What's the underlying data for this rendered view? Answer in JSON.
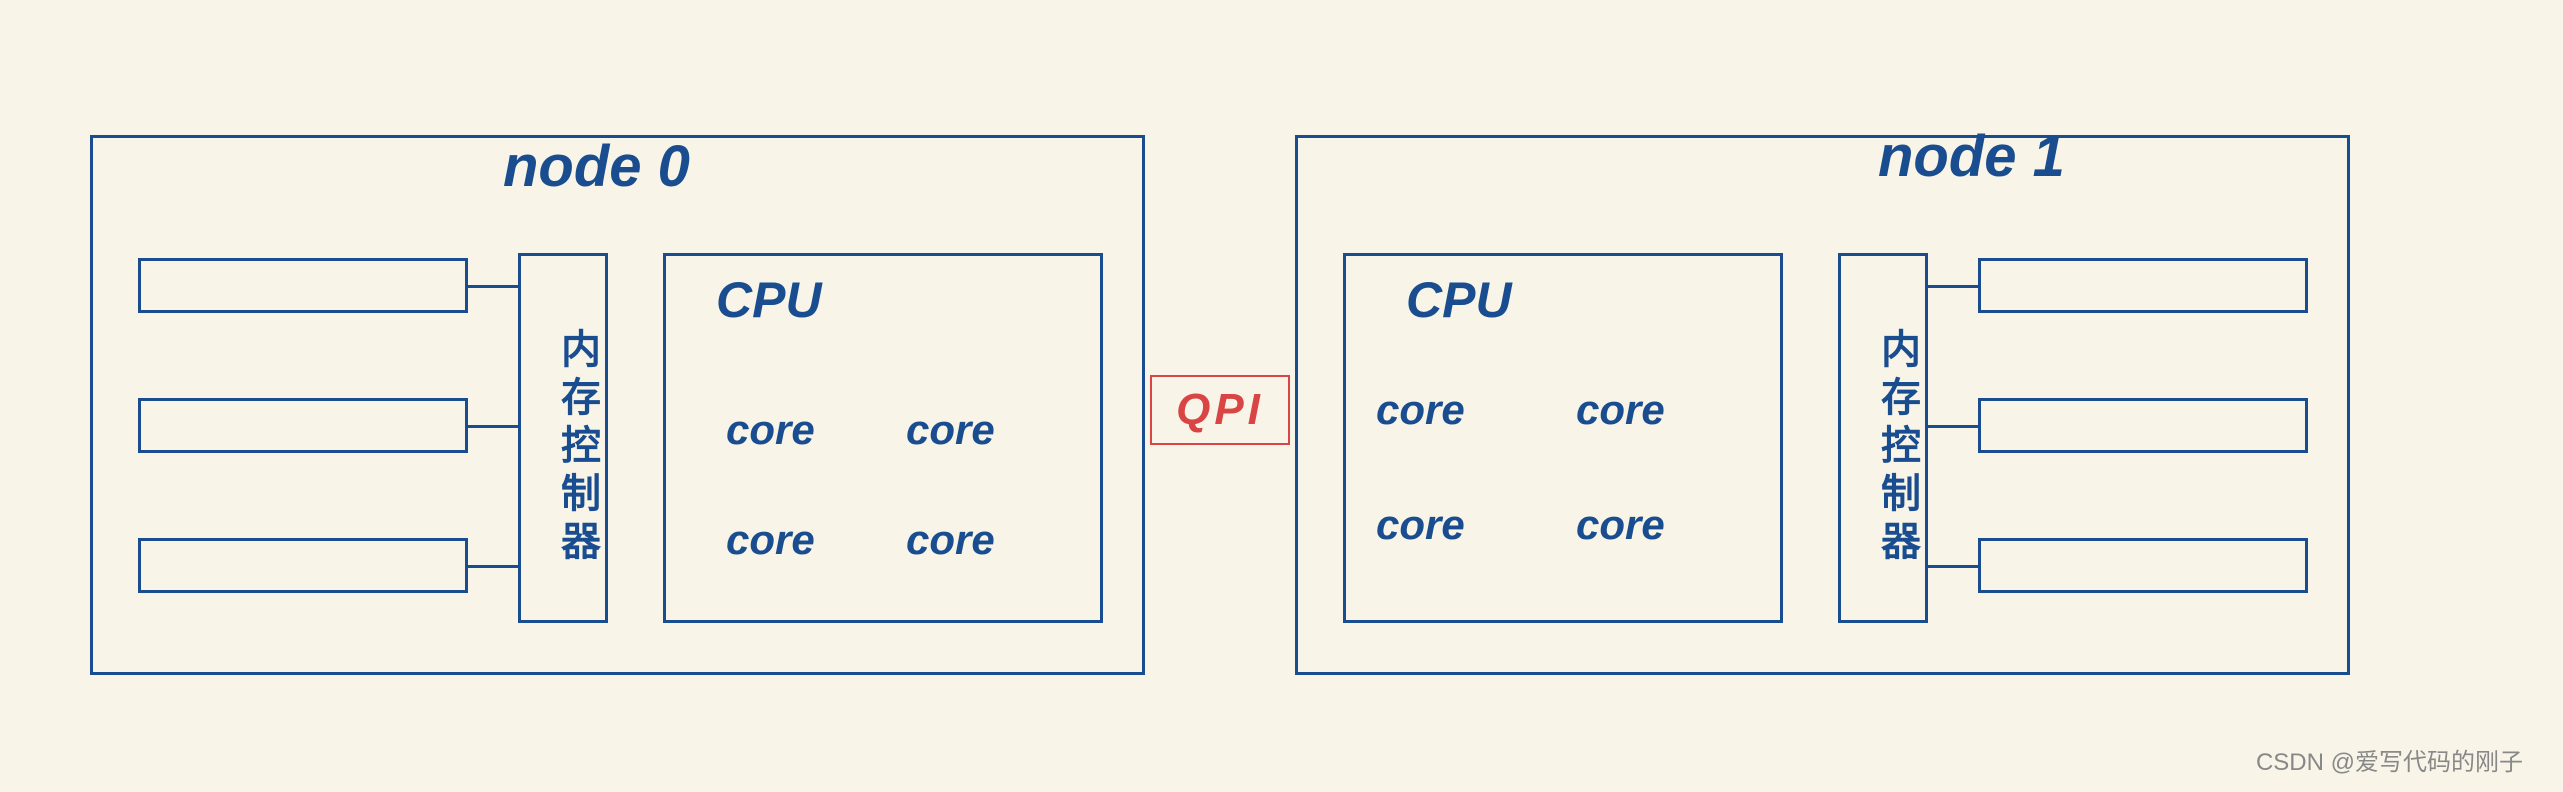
{
  "nodes": [
    {
      "title": "node 0",
      "mem_controller_label": "内存控制器",
      "cpu": {
        "label": "CPU",
        "cores": [
          "core",
          "core",
          "core",
          "core"
        ]
      }
    },
    {
      "title": "node 1",
      "mem_controller_label": "内存控制器",
      "cpu": {
        "label": "CPU",
        "cores": [
          "core",
          "core",
          "core",
          "core"
        ]
      }
    }
  ],
  "interconnect": "QPI",
  "credit": "CSDN @爱写代码的刚子"
}
